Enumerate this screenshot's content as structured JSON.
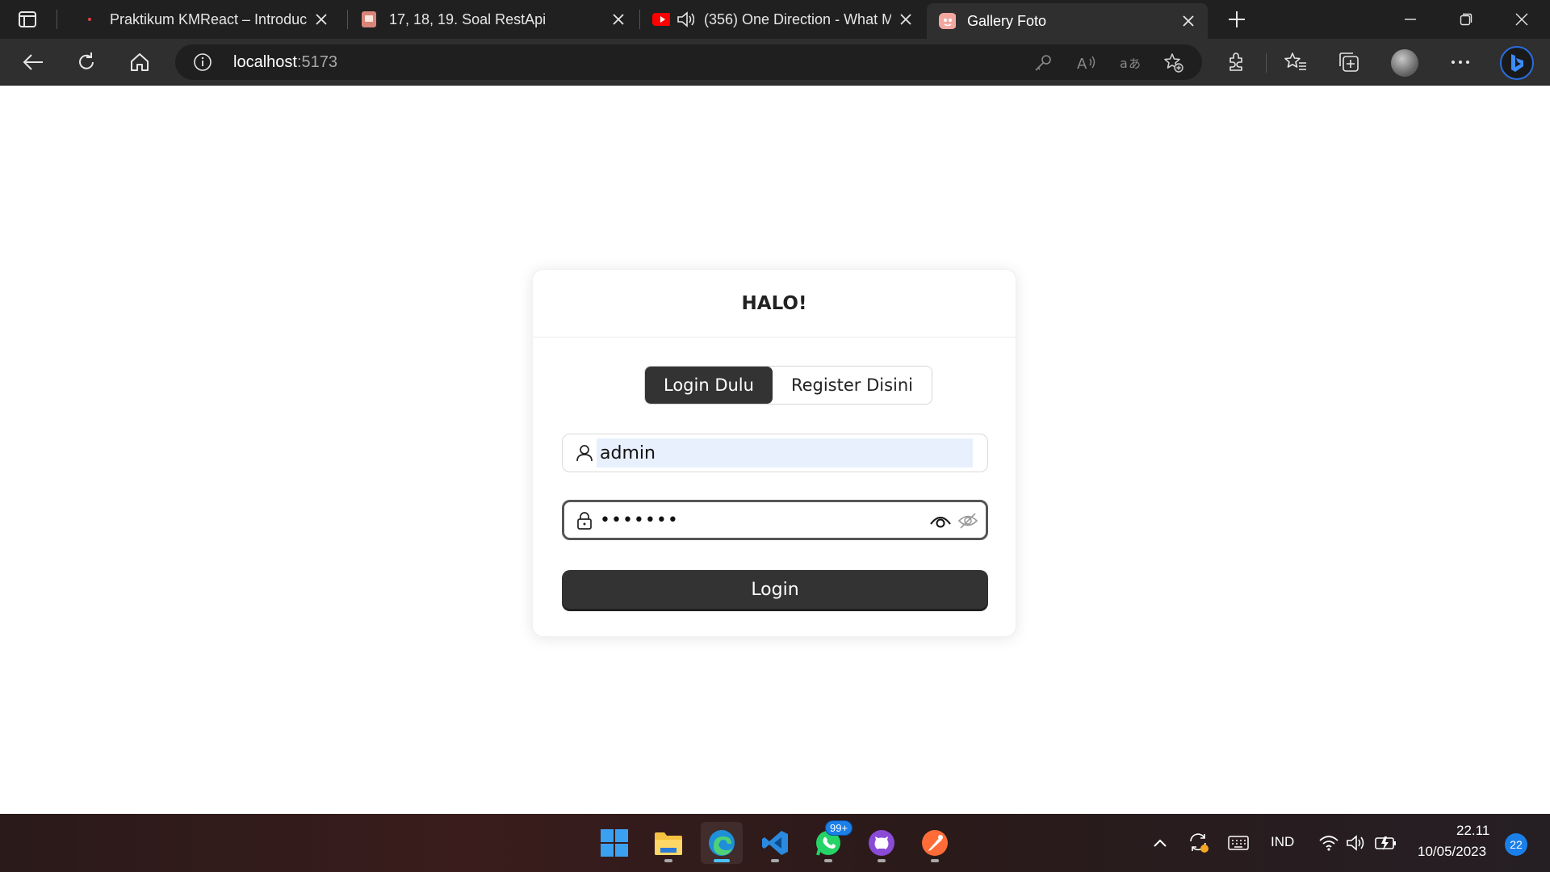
{
  "browser": {
    "tabs": [
      {
        "title": "Praktikum KMReact – Introductio",
        "favicon": "dot-icon"
      },
      {
        "title": "17, 18, 19. Soal RestApi",
        "favicon": "book-icon"
      },
      {
        "title": "(356) One Direction - What M",
        "favicon": "youtube-icon"
      },
      {
        "title": "Gallery Foto",
        "favicon": "gallery-icon"
      }
    ],
    "url_host": "localhost",
    "url_port": ":5173"
  },
  "card": {
    "title": "HALO!",
    "tabs": {
      "login": "Login Dulu",
      "register": "Register Disini"
    },
    "username_value": "admin",
    "password_value": "•••••••",
    "submit_label": "Login"
  },
  "taskbar": {
    "whatsapp_badge": "99+",
    "language": "IND",
    "time": "22.11",
    "date": "10/05/2023",
    "notifications": "22"
  },
  "colors": {
    "accent": "#333333",
    "autofill": "#e8f0fe",
    "chrome_dark": "#202020"
  }
}
